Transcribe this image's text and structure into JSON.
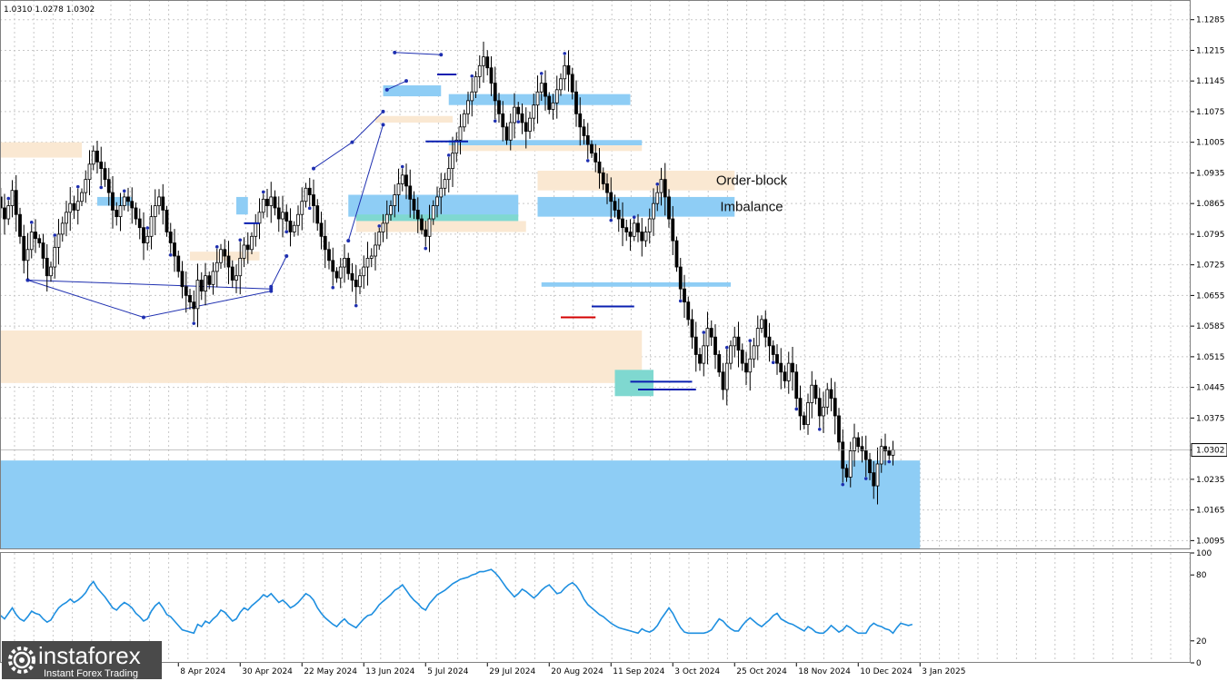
{
  "ohlc_header": "1.0310 1.0278 1.0302",
  "colors": {
    "supply_zone": "#fae8d2",
    "demand_zone": "#8ecdf5",
    "overlap_zone": "#7fd8d0",
    "candle": "#000000",
    "rsi": "#1e8fe0",
    "swing_line": "#1e2fb0",
    "level_red": "#d40000",
    "level_blue": "#0a1fb0",
    "grid": "#c8c8c8",
    "brand_bg": "#4a4a4a"
  },
  "brand": {
    "name": "instaforex",
    "tagline": "Instant Forex Trading",
    "icon": "gear-logo-icon"
  },
  "chart_data": {
    "type": "candlestick",
    "symbol_timeframe": "EURUSD D1",
    "price_axis": {
      "range": [
        1.0075,
        1.133
      ],
      "ticks": [
        "1.1285",
        "1.1215",
        "1.1145",
        "1.1075",
        "1.1005",
        "1.0935",
        "1.0865",
        "1.0795",
        "1.0725",
        "1.0655",
        "1.0585",
        "1.0515",
        "1.0445",
        "1.0375",
        "1.0302",
        "1.0235",
        "1.0165",
        "1.0095"
      ],
      "last_price": "1.0302"
    },
    "time_axis": {
      "labels": [
        "8 Apr 2024",
        "30 Apr 2024",
        "22 May 2024",
        "13 Jun 2024",
        "5 Jul 2024",
        "29 Jul 2024",
        "20 Aug 2024",
        "11 Sep 2024",
        "3 Oct 2024",
        "25 Oct 2024",
        "18 Nov 2024",
        "10 Dec 2024",
        "3 Jan 2025"
      ],
      "label_bar_index": [
        47,
        63,
        79,
        95,
        111,
        127,
        143,
        159,
        175,
        191,
        207,
        223,
        239
      ]
    },
    "candles_close": [
      1.088,
      1.0855,
      1.083,
      1.086,
      1.0895,
      1.084,
      1.079,
      1.0735,
      1.076,
      1.08,
      1.0785,
      1.0775,
      1.074,
      1.07,
      1.072,
      1.0765,
      1.0795,
      1.082,
      1.0845,
      1.0865,
      1.085,
      1.087,
      1.089,
      1.092,
      1.0955,
      1.0985,
      1.096,
      1.0945,
      1.092,
      1.089,
      1.085,
      1.0835,
      1.086,
      1.088,
      1.087,
      1.0855,
      1.083,
      1.081,
      1.0775,
      1.079,
      1.0835,
      1.086,
      1.088,
      1.085,
      1.08,
      1.0775,
      1.0745,
      1.071,
      1.0675,
      1.0655,
      1.064,
      1.0625,
      1.069,
      1.0665,
      1.07,
      1.068,
      1.071,
      1.073,
      1.076,
      1.0745,
      1.072,
      1.069,
      1.07,
      1.074,
      1.077,
      1.076,
      1.079,
      1.082,
      1.0845,
      1.0875,
      1.086,
      1.088,
      1.0855,
      1.083,
      1.0845,
      1.0825,
      1.08,
      1.0815,
      1.084,
      1.087,
      1.09,
      1.0885,
      1.086,
      1.082,
      1.079,
      1.076,
      1.0735,
      1.071,
      1.0695,
      1.072,
      1.074,
      1.0705,
      1.069,
      1.0675,
      1.07,
      1.072,
      1.074,
      1.0745,
      1.077,
      1.08,
      1.082,
      1.084,
      1.086,
      1.0885,
      1.091,
      1.093,
      1.0905,
      1.0875,
      1.085,
      1.083,
      1.0805,
      1.079,
      1.083,
      1.086,
      1.088,
      1.09,
      1.092,
      1.0945,
      1.098,
      1.101,
      1.104,
      1.107,
      1.11,
      1.112,
      1.1155,
      1.118,
      1.12,
      1.1175,
      1.114,
      1.11,
      1.107,
      1.104,
      1.101,
      1.105,
      1.1085,
      1.107,
      1.105,
      1.103,
      1.106,
      1.109,
      1.112,
      1.114,
      1.111,
      1.108,
      1.1095,
      1.1125,
      1.115,
      1.118,
      1.116,
      1.112,
      1.107,
      1.104,
      1.102,
      1.1,
      1.098,
      1.096,
      1.0935,
      1.091,
      1.089,
      1.087,
      1.085,
      1.083,
      1.081,
      1.08,
      1.079,
      1.082,
      1.08,
      1.078,
      1.08,
      1.083,
      1.0865,
      1.089,
      1.092,
      1.088,
      1.083,
      1.078,
      1.072,
      1.067,
      1.064,
      1.06,
      1.056,
      1.052,
      1.05,
      1.054,
      1.058,
      1.056,
      1.052,
      1.048,
      1.044,
      1.05,
      1.054,
      1.056,
      1.053,
      1.05,
      1.048,
      1.051,
      1.054,
      1.058,
      1.06,
      1.056,
      1.054,
      1.052,
      1.05,
      1.048,
      1.046,
      1.05,
      1.048,
      1.042,
      1.038,
      1.036,
      1.041,
      1.045,
      1.042,
      1.038,
      1.04,
      1.044,
      1.042,
      1.038,
      1.032,
      1.026,
      1.024,
      1.03,
      1.033,
      1.031,
      1.03,
      1.028,
      1.025,
      1.022,
      1.027,
      1.031,
      1.03,
      1.029,
      1.0302
    ],
    "zones": [
      {
        "type": "supply",
        "p_top": 1.1005,
        "p_bot": 1.097,
        "from": 0,
        "to": 22
      },
      {
        "type": "demand",
        "p_top": 1.088,
        "p_bot": 1.086,
        "from": 26,
        "to": 35
      },
      {
        "type": "demand",
        "p_top": 1.088,
        "p_bot": 1.084,
        "from": 62,
        "to": 65
      },
      {
        "type": "supply",
        "p_top": 1.0755,
        "p_bot": 1.0735,
        "from": 50,
        "to": 68
      },
      {
        "type": "supply",
        "p_top": 1.0575,
        "p_bot": 1.0455,
        "from": 0,
        "to": 167
      },
      {
        "type": "demand",
        "p_top": 1.0278,
        "p_bot": 1.0075,
        "from": 0,
        "to": 239
      },
      {
        "type": "demand",
        "p_top": 1.1135,
        "p_bot": 1.111,
        "from": 100,
        "to": 115
      },
      {
        "type": "demand",
        "p_top": 1.1115,
        "p_bot": 1.109,
        "from": 117,
        "to": 164
      },
      {
        "type": "supply",
        "p_top": 1.1065,
        "p_bot": 1.105,
        "from": 98,
        "to": 118
      },
      {
        "type": "demand",
        "p_top": 1.101,
        "p_bot": 1.0998,
        "from": 117,
        "to": 167
      },
      {
        "type": "supply",
        "p_top": 1.0998,
        "p_bot": 1.0985,
        "from": 117,
        "to": 167
      },
      {
        "type": "demand",
        "p_top": 1.0885,
        "p_bot": 1.0835,
        "from": 91,
        "to": 135
      },
      {
        "type": "overlap",
        "p_top": 1.084,
        "p_bot": 1.0825,
        "from": 93,
        "to": 135
      },
      {
        "type": "supply",
        "p_top": 1.0825,
        "p_bot": 1.08,
        "from": 93,
        "to": 137
      },
      {
        "type": "supply",
        "p_top": 1.094,
        "p_bot": 1.0895,
        "from": 140,
        "to": 191
      },
      {
        "type": "demand",
        "p_top": 1.088,
        "p_bot": 1.0835,
        "from": 140,
        "to": 191
      },
      {
        "type": "demand",
        "p_top": 1.0685,
        "p_bot": 1.0675,
        "from": 141,
        "to": 190
      },
      {
        "type": "overlap",
        "p_top": 1.0485,
        "p_bot": 1.0425,
        "from": 160,
        "to": 170
      }
    ],
    "annotations": [
      {
        "text": "Order-block",
        "price": 1.0918,
        "bar": 166
      },
      {
        "text": "Imbalance",
        "price": 1.0858,
        "bar": 166
      }
    ],
    "levels": [
      {
        "color": "red",
        "price": 1.0605,
        "from": 146,
        "to": 155
      },
      {
        "color": "blue",
        "price": 1.063,
        "from": 154,
        "to": 165
      },
      {
        "color": "blue",
        "price": 1.0458,
        "from": 164,
        "to": 180
      },
      {
        "color": "blue",
        "price": 1.044,
        "from": 166,
        "to": 181
      },
      {
        "color": "blue",
        "price": 1.082,
        "from": 64,
        "to": 68
      },
      {
        "color": "blue",
        "price": 1.1007,
        "from": 111,
        "to": 122
      },
      {
        "color": "blue",
        "price": 1.116,
        "from": 114,
        "to": 119
      }
    ],
    "swing_lines": [
      [
        [
          8,
          1.069
        ],
        [
          38,
          1.0605
        ],
        [
          71,
          1.0665
        ]
      ],
      [
        [
          8,
          1.069
        ],
        [
          71,
          1.067
        ]
      ],
      [
        [
          82,
          1.0945
        ],
        [
          92,
          1.1005
        ],
        [
          100,
          1.1075
        ]
      ],
      [
        [
          91,
          1.078
        ],
        [
          100,
          1.1045
        ]
      ],
      [
        [
          103,
          1.121
        ],
        [
          115,
          1.1205
        ]
      ],
      [
        [
          101,
          1.1125
        ],
        [
          106,
          1.1145
        ]
      ],
      [
        [
          71,
          1.0675
        ],
        [
          75,
          1.0745
        ]
      ]
    ],
    "rsi": {
      "axis_ticks": [
        "100",
        "80",
        "20",
        "0"
      ],
      "range": [
        0,
        100
      ],
      "values": [
        45,
        43,
        40,
        45,
        50,
        44,
        40,
        38,
        42,
        47,
        45,
        44,
        40,
        37,
        39,
        45,
        50,
        53,
        55,
        58,
        55,
        57,
        60,
        64,
        70,
        74,
        68,
        64,
        60,
        55,
        50,
        48,
        52,
        55,
        53,
        50,
        45,
        42,
        38,
        40,
        47,
        52,
        55,
        50,
        44,
        42,
        38,
        34,
        30,
        29,
        28,
        27,
        35,
        33,
        38,
        36,
        40,
        43,
        48,
        46,
        42,
        38,
        40,
        46,
        50,
        48,
        52,
        55,
        58,
        62,
        60,
        63,
        59,
        55,
        57,
        54,
        50,
        52,
        55,
        59,
        63,
        61,
        57,
        50,
        45,
        41,
        38,
        35,
        33,
        37,
        40,
        36,
        34,
        32,
        36,
        40,
        43,
        44,
        48,
        53,
        56,
        59,
        62,
        66,
        68,
        71,
        66,
        61,
        57,
        54,
        50,
        48,
        54,
        58,
        62,
        64,
        66,
        69,
        72,
        74,
        76,
        77,
        78,
        80,
        81,
        83,
        83,
        84,
        85,
        82,
        78,
        73,
        68,
        64,
        60,
        63,
        67,
        65,
        62,
        59,
        62,
        66,
        69,
        71,
        67,
        63,
        64,
        68,
        71,
        73,
        70,
        65,
        58,
        53,
        50,
        47,
        44,
        42,
        39,
        36,
        34,
        32,
        31,
        30,
        29,
        28,
        27,
        31,
        29,
        28,
        30,
        34,
        40,
        45,
        50,
        45,
        38,
        32,
        28,
        27,
        27,
        27,
        27,
        27,
        28,
        30,
        35,
        40,
        38,
        34,
        31,
        29,
        29,
        34,
        38,
        41,
        38,
        35,
        33,
        36,
        39,
        43,
        45,
        40,
        38,
        36,
        35,
        33,
        31,
        29,
        33,
        31,
        28,
        27,
        27,
        30,
        34,
        31,
        28,
        30,
        34,
        32,
        29,
        27,
        27,
        27,
        33,
        36,
        34,
        33,
        31,
        30,
        27,
        32,
        36,
        35,
        34,
        35
      ]
    }
  }
}
